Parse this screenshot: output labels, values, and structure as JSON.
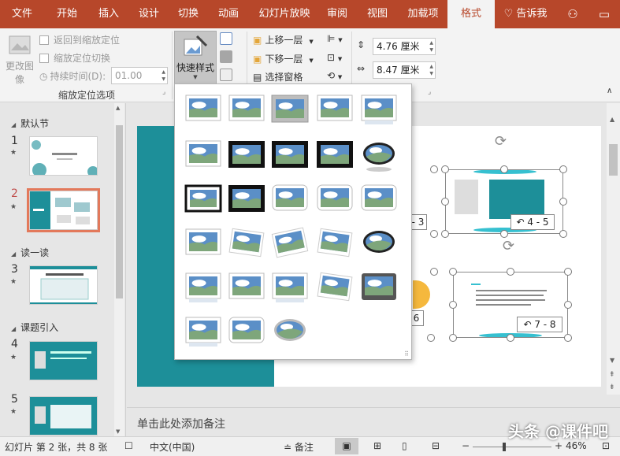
{
  "tabs": [
    "文件",
    "开始",
    "插入",
    "设计",
    "切换",
    "动画",
    "幻灯片放映",
    "审阅",
    "视图",
    "加载项",
    "格式"
  ],
  "tell_me": "告诉我",
  "ribbon": {
    "change_picture_line1": "更改图",
    "change_picture_line2": "像",
    "return_zoom": "返回到缩放定位",
    "zoom_toggle": "缩放定位切换",
    "duration_label": "持续时间(D):",
    "duration_value": "01.00",
    "zoom_group_label": "缩放定位选项",
    "quick_styles": "快速样式",
    "bring_forward": "上移一层",
    "send_backward": "下移一层",
    "selection_pane": "选择窗格",
    "height_value": "4.76 厘米",
    "width_value": "8.47 厘米"
  },
  "sections": [
    "默认节",
    "读一读",
    "课题引入"
  ],
  "slide_numbers": [
    "1",
    "2",
    "3",
    "4",
    "5"
  ],
  "slide_badges": [
    "4 - 5",
    "7 - 8",
    "- 3",
    "6"
  ],
  "notes_placeholder": "单击此处添加备注",
  "status": {
    "slide_info": "幻灯片 第 2 张，共 8 张",
    "language": "中文(中国)",
    "notes_btn": "备注",
    "zoom": "46%"
  },
  "watermark": "头条 @课件吧",
  "colors": {
    "accent": "#b7472a",
    "teal": "#1d8f99",
    "selected_slide": "#e3795b"
  }
}
